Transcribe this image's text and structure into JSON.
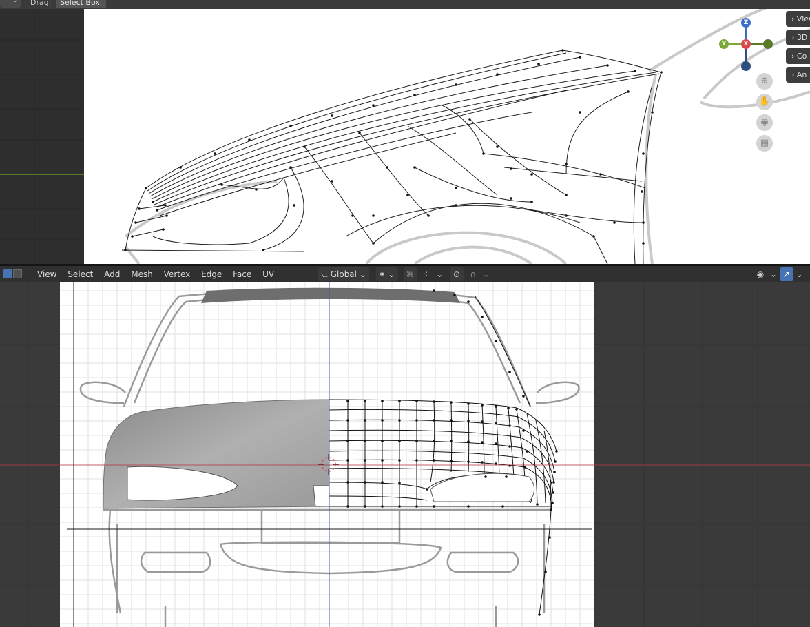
{
  "top_header": {
    "mode_dropdown": "⌄",
    "drag_label": "Drag:",
    "drag_value": "Select Box",
    "drag_caret": "⌄"
  },
  "side_tabs": [
    "View",
    "3D",
    "Co",
    "An"
  ],
  "gizmo": {
    "z": "Z",
    "y": "Y",
    "x": "X"
  },
  "bottom_header": {
    "menu": [
      "View",
      "Select",
      "Add",
      "Mesh",
      "Vertex",
      "Edge",
      "Face",
      "UV"
    ],
    "transform_orientation": "Global",
    "caret": "⌄"
  },
  "colors": {
    "accent_blue": "#4772b3",
    "axis_x_red": "#d84a4a",
    "axis_y_green": "#7aa83a",
    "axis_z_blue": "#3a6fc9",
    "viewport_bg": "#3a3a3a",
    "reference_bg": "#ffffff"
  }
}
